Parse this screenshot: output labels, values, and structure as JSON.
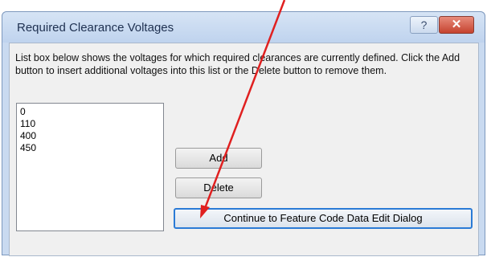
{
  "dialog": {
    "title": "Required Clearance Voltages",
    "help_label": "?",
    "close_label": "✕",
    "instructions": "List box below shows the voltages for which required clearances are currently defined. Click the Add button to insert additional voltages into this list or the Delete button to remove them.",
    "voltages": [
      "0",
      "110",
      "400",
      "450"
    ],
    "add_label": "Add",
    "delete_label": "Delete",
    "continue_label": "Continue to Feature Code Data Edit Dialog"
  },
  "colors": {
    "annotation_arrow": "#e02020",
    "focus_border": "#2b7bd6",
    "close_button": "#c5432f"
  }
}
